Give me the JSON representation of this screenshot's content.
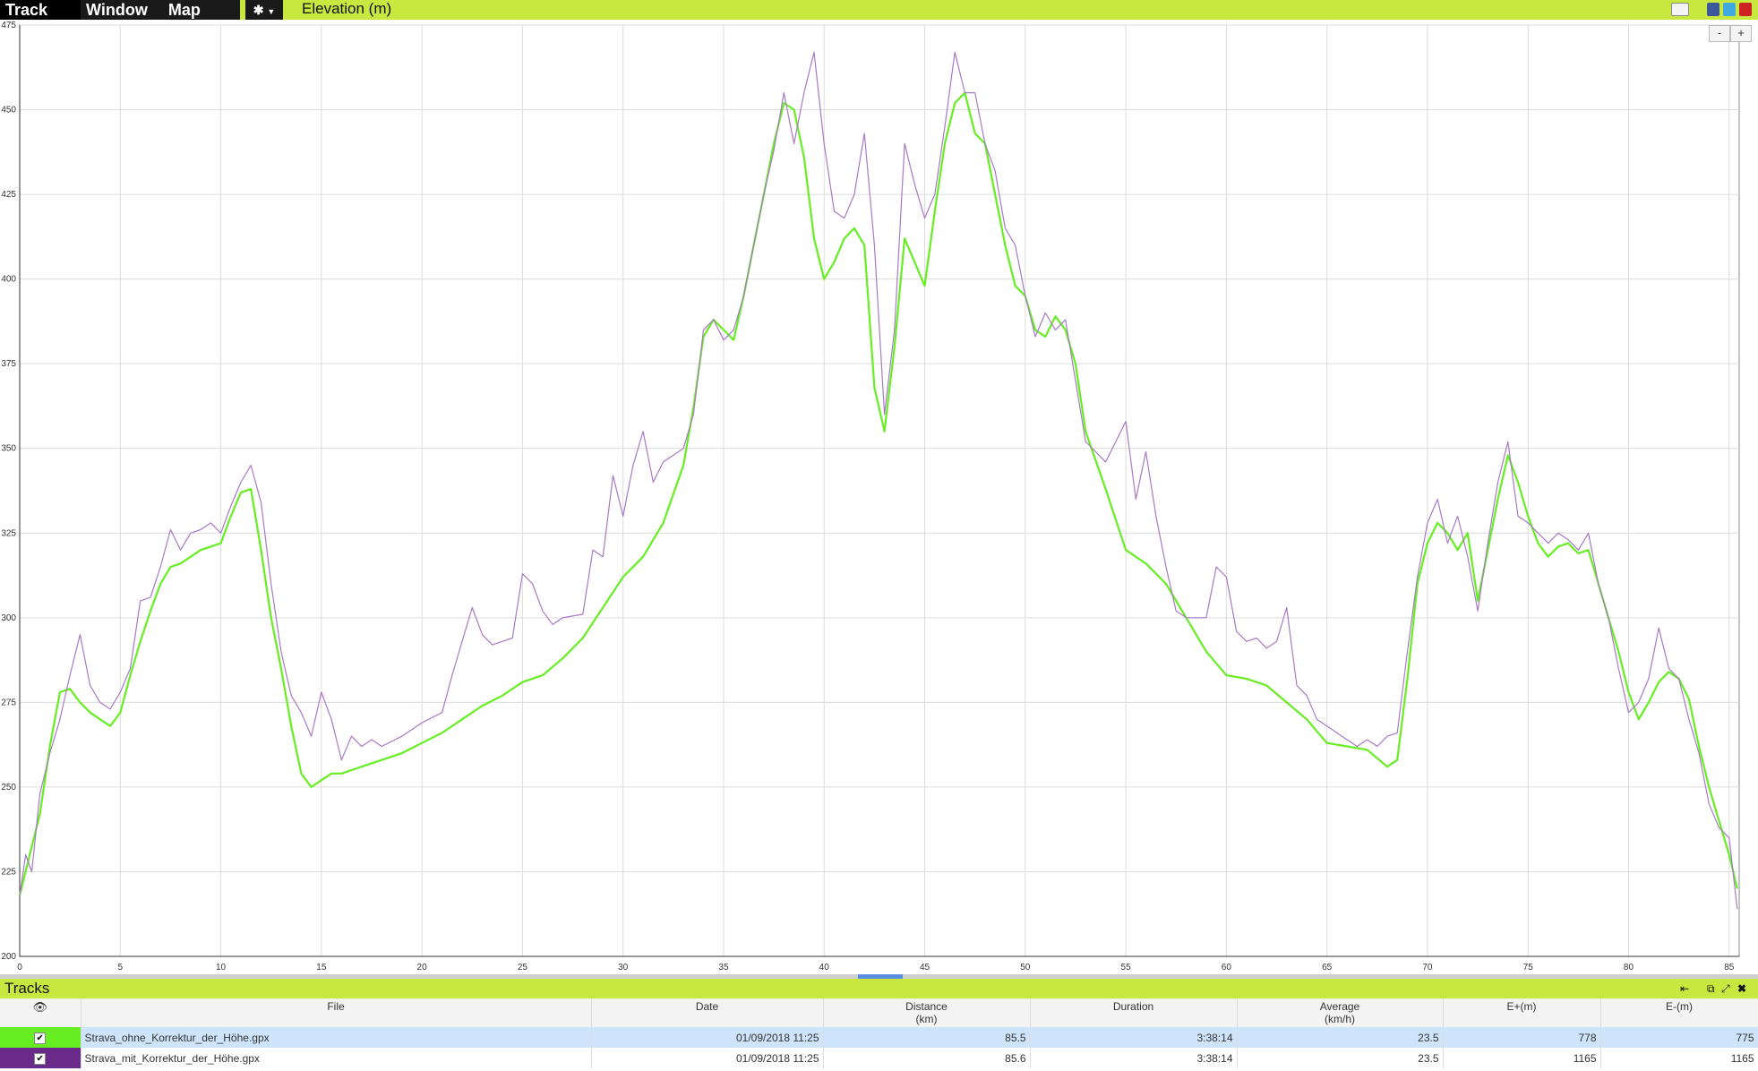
{
  "menu": {
    "track": "Track",
    "window": "Window",
    "map": "Map"
  },
  "chart_title": "Elevation (m)",
  "zoom": {
    "minus": "-",
    "plus": "+"
  },
  "chart_data": {
    "type": "line",
    "xlim": [
      0,
      85.5
    ],
    "ylim": [
      200,
      475
    ],
    "x_ticks": [
      0,
      5,
      10,
      15,
      20,
      25,
      30,
      35,
      40,
      45,
      50,
      55,
      60,
      65,
      70,
      75,
      80,
      85
    ],
    "y_ticks": [
      200,
      225,
      250,
      275,
      300,
      325,
      350,
      375,
      400,
      425,
      450,
      475
    ],
    "grid": true,
    "series": [
      {
        "color": "#66ee22",
        "points": [
          [
            0,
            218
          ],
          [
            0.5,
            230
          ],
          [
            1,
            242
          ],
          [
            1.5,
            262
          ],
          [
            2,
            278
          ],
          [
            2.5,
            279
          ],
          [
            3,
            275
          ],
          [
            3.5,
            272
          ],
          [
            4,
            270
          ],
          [
            4.5,
            268
          ],
          [
            5,
            272
          ],
          [
            5.5,
            283
          ],
          [
            6,
            293
          ],
          [
            6.5,
            302
          ],
          [
            7,
            310
          ],
          [
            7.5,
            315
          ],
          [
            8,
            316
          ],
          [
            8.5,
            318
          ],
          [
            9,
            320
          ],
          [
            9.5,
            321
          ],
          [
            10,
            322
          ],
          [
            10.5,
            330
          ],
          [
            11,
            337
          ],
          [
            11.5,
            338
          ],
          [
            12,
            320
          ],
          [
            12.5,
            300
          ],
          [
            13,
            285
          ],
          [
            13.5,
            268
          ],
          [
            14,
            254
          ],
          [
            14.5,
            250
          ],
          [
            15,
            252
          ],
          [
            15.5,
            254
          ],
          [
            16,
            254
          ],
          [
            16.5,
            255
          ],
          [
            17,
            256
          ],
          [
            18,
            258
          ],
          [
            19,
            260
          ],
          [
            20,
            263
          ],
          [
            21,
            266
          ],
          [
            22,
            270
          ],
          [
            23,
            274
          ],
          [
            24,
            277
          ],
          [
            25,
            281
          ],
          [
            26,
            283
          ],
          [
            27,
            288
          ],
          [
            28,
            294
          ],
          [
            29,
            303
          ],
          [
            30,
            312
          ],
          [
            31,
            318
          ],
          [
            32,
            328
          ],
          [
            33,
            345
          ],
          [
            33.5,
            362
          ],
          [
            34,
            383
          ],
          [
            34.5,
            388
          ],
          [
            35,
            385
          ],
          [
            35.5,
            382
          ],
          [
            36,
            395
          ],
          [
            36.5,
            410
          ],
          [
            37,
            425
          ],
          [
            37.5,
            440
          ],
          [
            38,
            452
          ],
          [
            38.5,
            450
          ],
          [
            39,
            436
          ],
          [
            39.5,
            412
          ],
          [
            40,
            400
          ],
          [
            40.5,
            405
          ],
          [
            41,
            412
          ],
          [
            41.5,
            415
          ],
          [
            42,
            410
          ],
          [
            42.5,
            368
          ],
          [
            43,
            355
          ],
          [
            43.5,
            380
          ],
          [
            44,
            412
          ],
          [
            44.5,
            405
          ],
          [
            45,
            398
          ],
          [
            45.5,
            420
          ],
          [
            46,
            440
          ],
          [
            46.5,
            452
          ],
          [
            47,
            455
          ],
          [
            47.5,
            443
          ],
          [
            48,
            440
          ],
          [
            48.5,
            425
          ],
          [
            49,
            410
          ],
          [
            49.5,
            398
          ],
          [
            50,
            395
          ],
          [
            50.5,
            385
          ],
          [
            51,
            383
          ],
          [
            51.5,
            389
          ],
          [
            52,
            385
          ],
          [
            52.5,
            375
          ],
          [
            53,
            355
          ],
          [
            54,
            338
          ],
          [
            55,
            320
          ],
          [
            56,
            316
          ],
          [
            57,
            310
          ],
          [
            58,
            300
          ],
          [
            59,
            290
          ],
          [
            60,
            283
          ],
          [
            61,
            282
          ],
          [
            62,
            280
          ],
          [
            63,
            275
          ],
          [
            64,
            270
          ],
          [
            65,
            263
          ],
          [
            66,
            262
          ],
          [
            67,
            261
          ],
          [
            68,
            256
          ],
          [
            68.5,
            258
          ],
          [
            69,
            282
          ],
          [
            69.5,
            310
          ],
          [
            70,
            322
          ],
          [
            70.5,
            328
          ],
          [
            71,
            325
          ],
          [
            71.5,
            320
          ],
          [
            72,
            325
          ],
          [
            72.5,
            305
          ],
          [
            73,
            320
          ],
          [
            73.5,
            335
          ],
          [
            74,
            348
          ],
          [
            74.5,
            340
          ],
          [
            75,
            330
          ],
          [
            75.5,
            322
          ],
          [
            76,
            318
          ],
          [
            76.5,
            321
          ],
          [
            77,
            322
          ],
          [
            77.5,
            319
          ],
          [
            78,
            320
          ],
          [
            78.5,
            310
          ],
          [
            79,
            300
          ],
          [
            79.5,
            290
          ],
          [
            80,
            278
          ],
          [
            80.5,
            270
          ],
          [
            81,
            275
          ],
          [
            81.5,
            281
          ],
          [
            82,
            284
          ],
          [
            82.5,
            282
          ],
          [
            83,
            276
          ],
          [
            83.5,
            262
          ],
          [
            84,
            250
          ],
          [
            84.5,
            240
          ],
          [
            85,
            230
          ],
          [
            85.4,
            220
          ]
        ]
      },
      {
        "color": "#a879c7",
        "points": [
          [
            0,
            218
          ],
          [
            0.3,
            230
          ],
          [
            0.6,
            225
          ],
          [
            1,
            248
          ],
          [
            1.5,
            260
          ],
          [
            2,
            270
          ],
          [
            2.5,
            283
          ],
          [
            3,
            295
          ],
          [
            3.5,
            280
          ],
          [
            4,
            275
          ],
          [
            4.5,
            273
          ],
          [
            5,
            278
          ],
          [
            5.5,
            285
          ],
          [
            6,
            305
          ],
          [
            6.5,
            306
          ],
          [
            7,
            315
          ],
          [
            7.5,
            326
          ],
          [
            8,
            320
          ],
          [
            8.5,
            325
          ],
          [
            9,
            326
          ],
          [
            9.5,
            328
          ],
          [
            10,
            325
          ],
          [
            10.5,
            333
          ],
          [
            11,
            340
          ],
          [
            11.5,
            345
          ],
          [
            12,
            334
          ],
          [
            12.5,
            310
          ],
          [
            13,
            290
          ],
          [
            13.5,
            277
          ],
          [
            14,
            272
          ],
          [
            14.5,
            265
          ],
          [
            15,
            278
          ],
          [
            15.5,
            270
          ],
          [
            16,
            258
          ],
          [
            16.5,
            265
          ],
          [
            17,
            262
          ],
          [
            17.5,
            264
          ],
          [
            18,
            262
          ],
          [
            19,
            265
          ],
          [
            20,
            269
          ],
          [
            21,
            272
          ],
          [
            21.5,
            283
          ],
          [
            22,
            293
          ],
          [
            22.5,
            303
          ],
          [
            23,
            295
          ],
          [
            23.5,
            292
          ],
          [
            24,
            293
          ],
          [
            24.5,
            294
          ],
          [
            25,
            313
          ],
          [
            25.5,
            310
          ],
          [
            26,
            302
          ],
          [
            26.5,
            298
          ],
          [
            27,
            300
          ],
          [
            28,
            301
          ],
          [
            28.5,
            320
          ],
          [
            29,
            318
          ],
          [
            29.5,
            342
          ],
          [
            30,
            330
          ],
          [
            30.5,
            345
          ],
          [
            31,
            355
          ],
          [
            31.5,
            340
          ],
          [
            32,
            346
          ],
          [
            33,
            350
          ],
          [
            33.5,
            360
          ],
          [
            34,
            385
          ],
          [
            34.5,
            388
          ],
          [
            35,
            382
          ],
          [
            35.5,
            385
          ],
          [
            36,
            395
          ],
          [
            36.5,
            410
          ],
          [
            37,
            425
          ],
          [
            37.5,
            438
          ],
          [
            38,
            455
          ],
          [
            38.5,
            440
          ],
          [
            39,
            455
          ],
          [
            39.5,
            467
          ],
          [
            40,
            440
          ],
          [
            40.5,
            420
          ],
          [
            41,
            418
          ],
          [
            41.5,
            425
          ],
          [
            42,
            443
          ],
          [
            42.5,
            410
          ],
          [
            43,
            360
          ],
          [
            43.5,
            385
          ],
          [
            44,
            440
          ],
          [
            44.5,
            428
          ],
          [
            45,
            418
          ],
          [
            45.5,
            425
          ],
          [
            46,
            445
          ],
          [
            46.5,
            467
          ],
          [
            47,
            455
          ],
          [
            47.5,
            455
          ],
          [
            48,
            440
          ],
          [
            48.5,
            432
          ],
          [
            49,
            415
          ],
          [
            49.5,
            410
          ],
          [
            50,
            395
          ],
          [
            50.5,
            383
          ],
          [
            51,
            390
          ],
          [
            51.5,
            385
          ],
          [
            52,
            388
          ],
          [
            52.5,
            370
          ],
          [
            53,
            352
          ],
          [
            53.5,
            349
          ],
          [
            54,
            346
          ],
          [
            55,
            358
          ],
          [
            55.5,
            335
          ],
          [
            56,
            349
          ],
          [
            56.5,
            330
          ],
          [
            57,
            315
          ],
          [
            57.5,
            302
          ],
          [
            58,
            300
          ],
          [
            59,
            300
          ],
          [
            59.5,
            315
          ],
          [
            60,
            312
          ],
          [
            60.5,
            296
          ],
          [
            61,
            293
          ],
          [
            61.5,
            294
          ],
          [
            62,
            291
          ],
          [
            62.5,
            293
          ],
          [
            63,
            303
          ],
          [
            63.5,
            280
          ],
          [
            64,
            277
          ],
          [
            64.5,
            270
          ],
          [
            65,
            268
          ],
          [
            66,
            264
          ],
          [
            66.5,
            262
          ],
          [
            67,
            264
          ],
          [
            67.5,
            262
          ],
          [
            68,
            265
          ],
          [
            68.5,
            266
          ],
          [
            69,
            290
          ],
          [
            69.5,
            312
          ],
          [
            70,
            328
          ],
          [
            70.5,
            335
          ],
          [
            71,
            322
          ],
          [
            71.5,
            330
          ],
          [
            72,
            318
          ],
          [
            72.5,
            302
          ],
          [
            73,
            322
          ],
          [
            73.5,
            340
          ],
          [
            74,
            352
          ],
          [
            74.5,
            330
          ],
          [
            75,
            328
          ],
          [
            75.5,
            325
          ],
          [
            76,
            322
          ],
          [
            76.5,
            325
          ],
          [
            77,
            323
          ],
          [
            77.5,
            320
          ],
          [
            78,
            325
          ],
          [
            78.5,
            310
          ],
          [
            79,
            300
          ],
          [
            79.5,
            285
          ],
          [
            80,
            272
          ],
          [
            80.5,
            275
          ],
          [
            81,
            282
          ],
          [
            81.5,
            297
          ],
          [
            82,
            285
          ],
          [
            82.5,
            282
          ],
          [
            83,
            270
          ],
          [
            83.5,
            260
          ],
          [
            84,
            245
          ],
          [
            84.5,
            238
          ],
          [
            85,
            235
          ],
          [
            85.4,
            214
          ]
        ]
      }
    ]
  },
  "tracks_panel": {
    "title": "Tracks",
    "columns": {
      "file": "File",
      "date": "Date",
      "distance": "Distance",
      "distance_unit": "(km)",
      "duration": "Duration",
      "average": "Average",
      "average_unit": "(km/h)",
      "eplus": "E+(m)",
      "eminus": "E-(m)"
    },
    "rows": [
      {
        "color": "#66ee22",
        "file": "Strava_ohne_Korrektur_der_Höhe.gpx",
        "date": "01/09/2018 11:25",
        "distance": "85.5",
        "duration": "3:38:14",
        "average": "23.5",
        "eplus": "778",
        "eminus": "775"
      },
      {
        "color": "#6a2a8a",
        "file": "Strava_mit_Korrektur_der_Höhe.gpx",
        "date": "01/09/2018 11:25",
        "distance": "85.6",
        "duration": "3:38:14",
        "average": "23.5",
        "eplus": "1165",
        "eminus": "1165"
      }
    ]
  }
}
